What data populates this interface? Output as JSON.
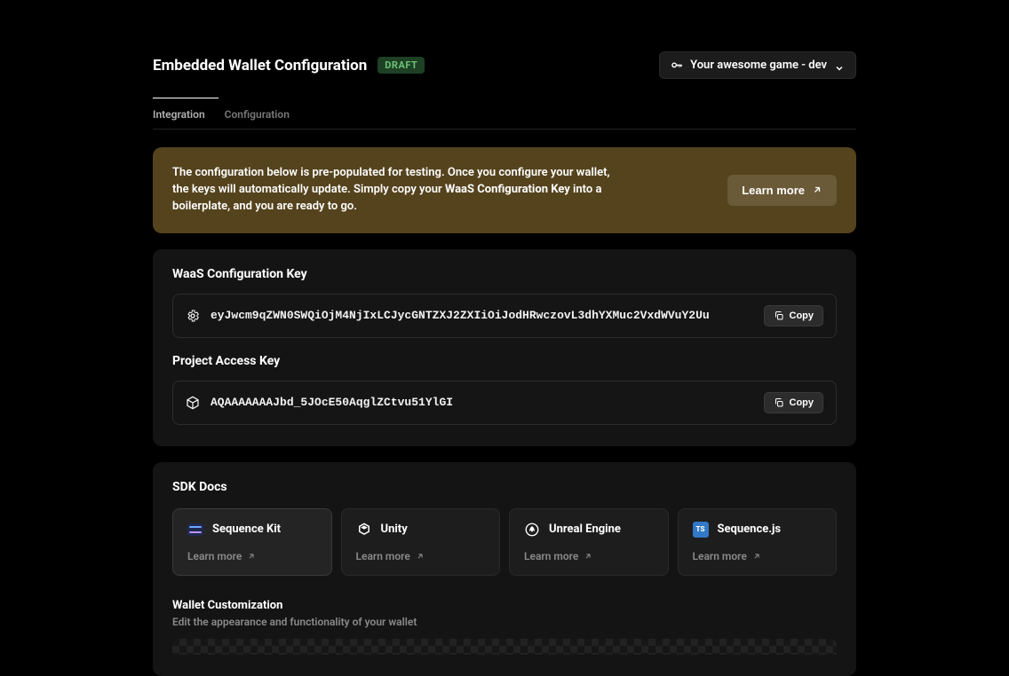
{
  "header": {
    "title": "Embedded Wallet Configuration",
    "badge": "DRAFT",
    "project_name": "Your awesome game - dev"
  },
  "tabs": {
    "integration": "Integration",
    "configuration": "Configuration"
  },
  "notice": {
    "prefix": "The configuration below is pre-populated for testing. Once you configure your wallet, the keys will automatically update. Simply copy your ",
    "bold": "WaaS Configuration Key",
    "suffix": " into a boilerplate, and you are ready to go.",
    "button": "Learn more"
  },
  "keys": {
    "waas_label": "WaaS Configuration Key",
    "waas_value": "eyJwcm9qZWN0SWQiOjM4NjIxLCJycGNTZXJ2ZXIiOiJodHRwczovL3dhYXMuc2VxdWVuY2Uu",
    "project_label": "Project Access Key",
    "project_value": "AQAAAAAAAJbd_5JOcE50AqglZCtvu51YlGI",
    "copy_label": "Copy"
  },
  "sdk": {
    "heading": "SDK Docs",
    "learn_more": "Learn more",
    "items": [
      {
        "name": "Sequence Kit"
      },
      {
        "name": "Unity"
      },
      {
        "name": "Unreal Engine"
      },
      {
        "name": "Sequence.js"
      }
    ]
  },
  "customization": {
    "heading": "Wallet Customization",
    "sub": "Edit the appearance and functionality of your wallet"
  }
}
